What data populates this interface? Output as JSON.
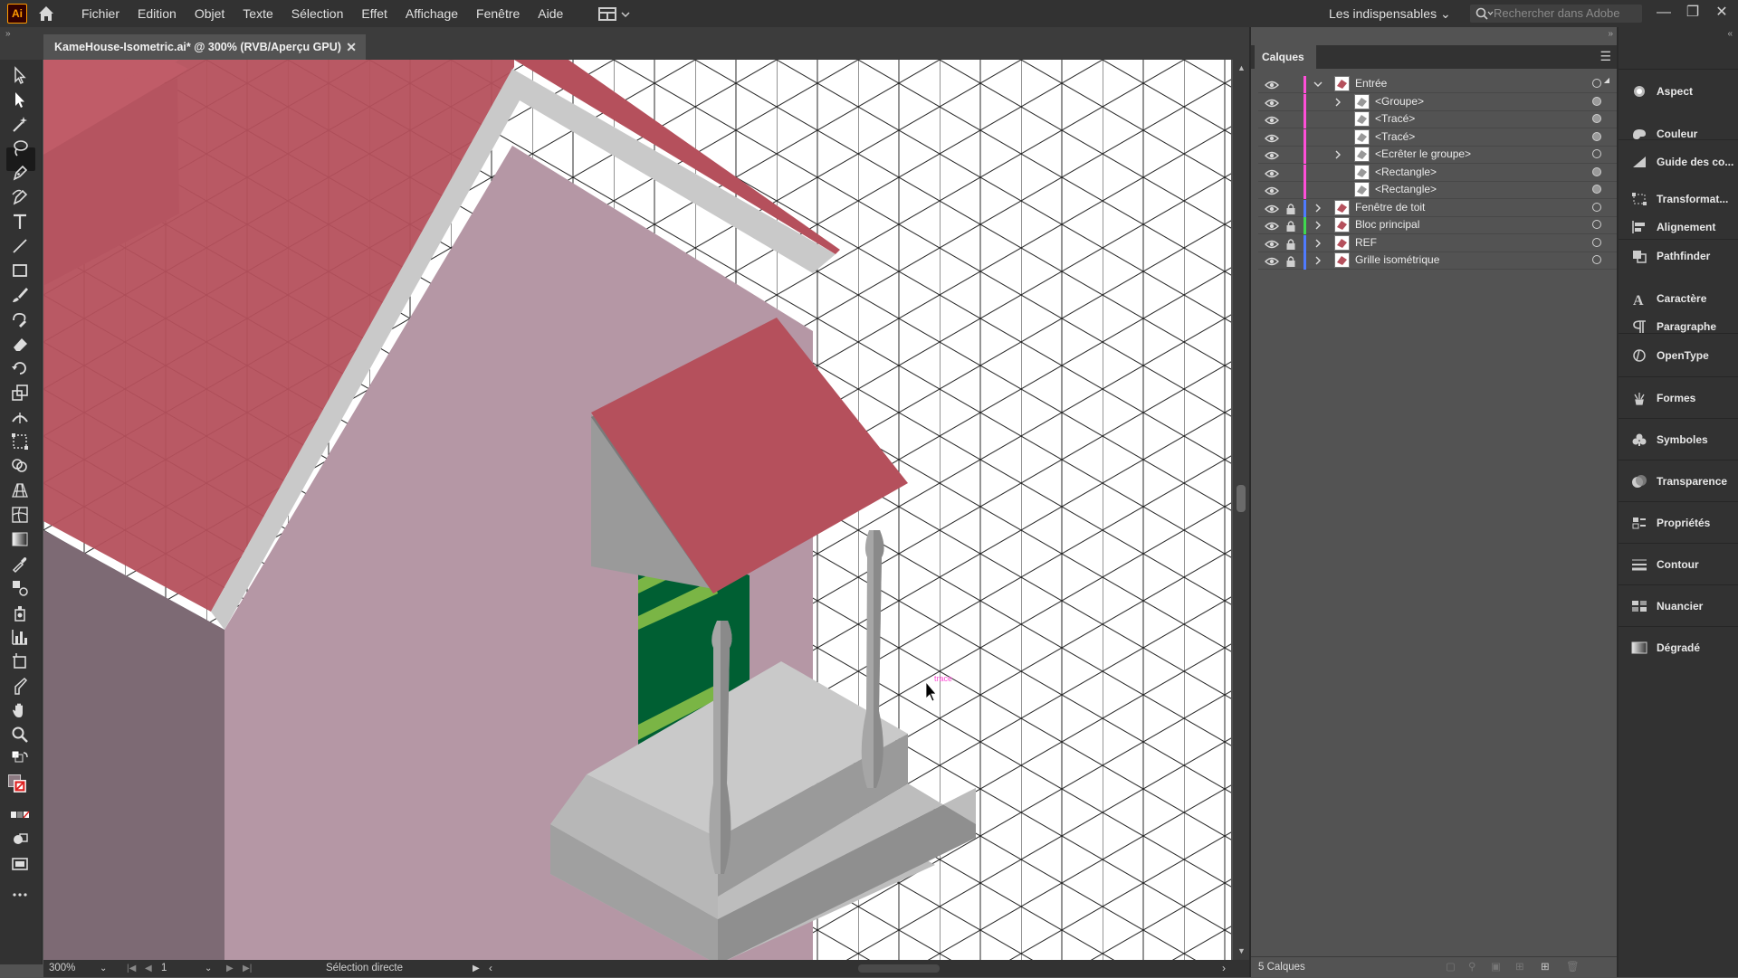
{
  "menubar": {
    "app_badge": "Ai",
    "items": [
      "Fichier",
      "Edition",
      "Objet",
      "Texte",
      "Sélection",
      "Effet",
      "Affichage",
      "Fenêtre",
      "Aide"
    ],
    "workspace": "Les indispensables",
    "search_placeholder": "Rechercher dans Adobe Stoc"
  },
  "document": {
    "tab_title": "KameHouse-Isometric.ai* @ 300% (RVB/Aperçu GPU)"
  },
  "canvas": {
    "cursor_hint": "trace"
  },
  "statusbar": {
    "zoom": "300%",
    "artboard": "1",
    "tool": "Sélection directe"
  },
  "layers": {
    "panel_title": "Calques",
    "footer_count": "5 Calques",
    "rows": [
      {
        "name": "Entrée",
        "level": 0,
        "expanded": true,
        "locked": false,
        "color": "#ff4fd8",
        "target_filled": false
      },
      {
        "name": "<Groupe>",
        "level": 1,
        "expanded": false,
        "locked": false,
        "color": "#ff4fd8",
        "target_filled": true
      },
      {
        "name": "<Tracé>",
        "level": 1,
        "expanded": null,
        "locked": false,
        "color": "#ff4fd8",
        "target_filled": true
      },
      {
        "name": "<Tracé>",
        "level": 1,
        "expanded": null,
        "locked": false,
        "color": "#ff4fd8",
        "target_filled": true
      },
      {
        "name": "<Ecrêter le groupe>",
        "level": 1,
        "expanded": false,
        "locked": false,
        "color": "#ff4fd8",
        "target_filled": false
      },
      {
        "name": "<Rectangle>",
        "level": 1,
        "expanded": null,
        "locked": false,
        "color": "#ff4fd8",
        "target_filled": true
      },
      {
        "name": "<Rectangle>",
        "level": 1,
        "expanded": null,
        "locked": false,
        "color": "#ff4fd8",
        "target_filled": true
      },
      {
        "name": "Fenêtre de toit",
        "level": 0,
        "expanded": false,
        "locked": true,
        "color": "#4f7bff",
        "target_filled": false
      },
      {
        "name": "Bloc principal",
        "level": 0,
        "expanded": false,
        "locked": true,
        "color": "#3fd84f",
        "target_filled": false
      },
      {
        "name": "REF",
        "level": 0,
        "expanded": false,
        "locked": true,
        "color": "#4f7bff",
        "target_filled": false
      },
      {
        "name": "Grille isométrique",
        "level": 0,
        "expanded": false,
        "locked": true,
        "color": "#4f7bff",
        "target_filled": false
      }
    ]
  },
  "dock": {
    "items": [
      {
        "label": "Aspect",
        "icon": "appearance-icon"
      },
      {
        "label": "Couleur",
        "icon": "color-icon"
      },
      {
        "label": "Guide des co...",
        "icon": "color-guide-icon"
      },
      {
        "label": "Transformat...",
        "icon": "transform-icon"
      },
      {
        "label": "Alignement",
        "icon": "align-icon"
      },
      {
        "label": "Pathfinder",
        "icon": "pathfinder-icon"
      },
      {
        "label": "Caractère",
        "icon": "character-icon"
      },
      {
        "label": "Paragraphe",
        "icon": "paragraph-icon"
      },
      {
        "label": "OpenType",
        "icon": "opentype-icon"
      },
      {
        "label": "Formes",
        "icon": "brushes-icon"
      },
      {
        "label": "Symboles",
        "icon": "symbols-icon"
      },
      {
        "label": "Transparence",
        "icon": "transparency-icon"
      },
      {
        "label": "Propriétés",
        "icon": "properties-icon"
      },
      {
        "label": "Contour",
        "icon": "stroke-icon"
      },
      {
        "label": "Nuancier",
        "icon": "swatches-icon"
      },
      {
        "label": "Dégradé",
        "icon": "gradient-icon"
      }
    ]
  },
  "colors": {
    "roof": "#b5505c",
    "wall": "#b597a5",
    "wall_dark": "#7d6a74",
    "porch": "#a7a7a7",
    "window": "#005f33",
    "window_frame": "#7ab545"
  }
}
